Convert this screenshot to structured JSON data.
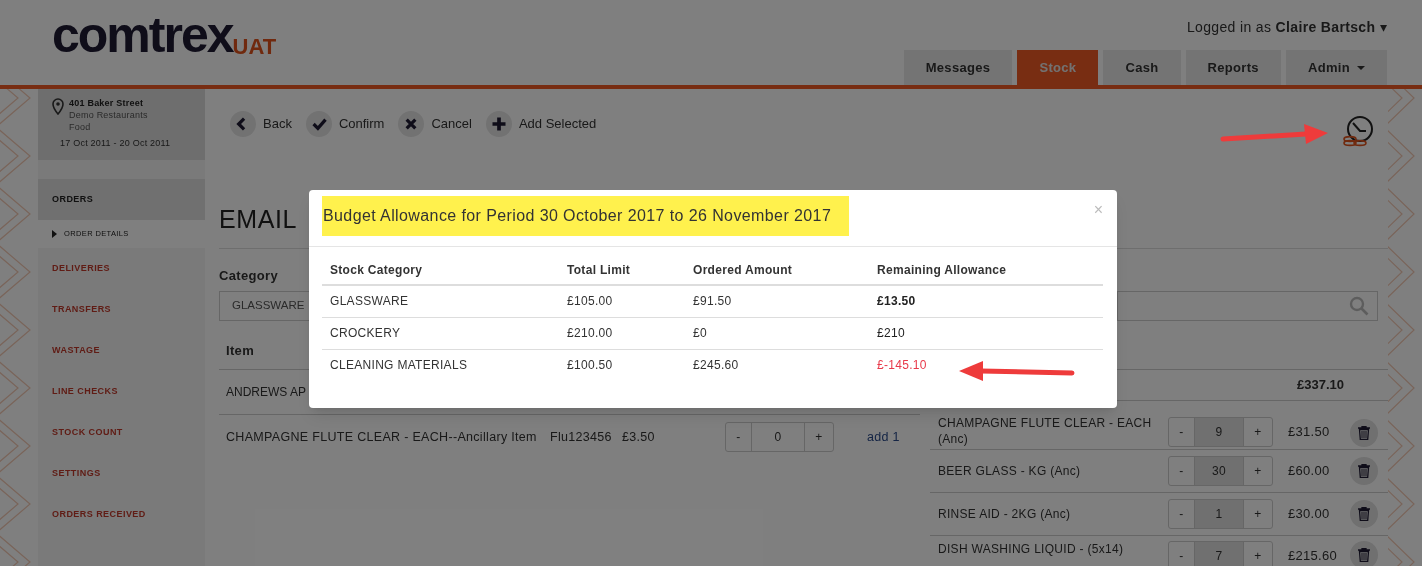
{
  "logo": {
    "name": "comtrex",
    "badge": "UAT"
  },
  "user": {
    "prefix": "Logged in as",
    "name": "Claire Bartsch",
    "caret": "▾"
  },
  "tabs": [
    {
      "label": "Messages",
      "selected": false,
      "dropdown": false
    },
    {
      "label": "Stock",
      "selected": true,
      "dropdown": false
    },
    {
      "label": "Cash",
      "selected": false,
      "dropdown": false
    },
    {
      "label": "Reports",
      "selected": false,
      "dropdown": false
    },
    {
      "label": "Admin",
      "selected": false,
      "dropdown": true
    }
  ],
  "location": {
    "name": "401 Baker Street",
    "company": "Demo Restaurants",
    "type": "Food",
    "period": "17 Oct 2011 - 20 Oct 2011"
  },
  "sidebar": {
    "items": [
      {
        "label": "ORDERS",
        "selected": true,
        "children": [
          {
            "label": "ORDER DETAILS",
            "selected": true
          }
        ]
      },
      {
        "label": "DELIVERIES",
        "selected": false
      },
      {
        "label": "TRANSFERS",
        "selected": false
      },
      {
        "label": "WASTAGE",
        "selected": false
      },
      {
        "label": "LINE CHECKS",
        "selected": false
      },
      {
        "label": "STOCK COUNT",
        "selected": false
      },
      {
        "label": "SETTINGS",
        "selected": false
      },
      {
        "label": "ORDERS RECEIVED",
        "selected": false
      }
    ]
  },
  "toolbar": [
    {
      "label": "Back",
      "kind": "back"
    },
    {
      "label": "Confirm",
      "kind": "confirm"
    },
    {
      "label": "Cancel",
      "kind": "cancel"
    },
    {
      "label": "Add Selected",
      "kind": "add"
    }
  ],
  "page": {
    "title": "EMAIL",
    "category_label": "Category",
    "category_value": "GLASSWARE",
    "items_header": "Item",
    "items": [
      {
        "name": "ANDREWS AP"
      },
      {
        "name": "CHAMPAGNE FLUTE CLEAR - EACH--Ancillary Item",
        "code": "Flu123456",
        "price": "£3.50",
        "minus": "-",
        "quantity": "0",
        "plus": "+",
        "action": "add 1"
      }
    ]
  },
  "order": {
    "total": "£337.10",
    "lines": [
      {
        "name": "CHAMPAGNE FLUTE CLEAR - EACH (Anc)",
        "minus": "-",
        "quantity": "9",
        "plus": "+",
        "amount": "£31.50"
      },
      {
        "name": "BEER GLASS - KG (Anc)",
        "minus": "-",
        "quantity": "30",
        "plus": "+",
        "amount": "£60.00"
      },
      {
        "name": "RINSE AID - 2KG (Anc)",
        "minus": "-",
        "quantity": "1",
        "plus": "+",
        "amount": "£30.00"
      },
      {
        "name": "DISH WASHING LIQUID - (5x14)",
        "minus": "-",
        "quantity": "7",
        "plus": "+",
        "amount": "£215.60"
      }
    ]
  },
  "modal": {
    "title": "Budget Allowance for Period 30 October 2017 to 26 November 2017",
    "highlighted": true,
    "close": "×",
    "columns": [
      "Stock Category",
      "Total Limit",
      "Ordered Amount",
      "Remaining Allowance"
    ],
    "rows": [
      {
        "cells": [
          "GLASSWARE",
          "£105.00",
          "£91.50",
          "£13.50"
        ],
        "emphasized": true,
        "over_budget": false
      },
      {
        "cells": [
          "CROCKERY",
          "£210.00",
          "£0",
          "£210"
        ],
        "emphasized": false,
        "over_budget": false
      },
      {
        "cells": [
          "CLEANING MATERIALS",
          "£100.50",
          "£245.60",
          "£-145.10"
        ],
        "emphasized": false,
        "over_budget": true
      }
    ]
  }
}
